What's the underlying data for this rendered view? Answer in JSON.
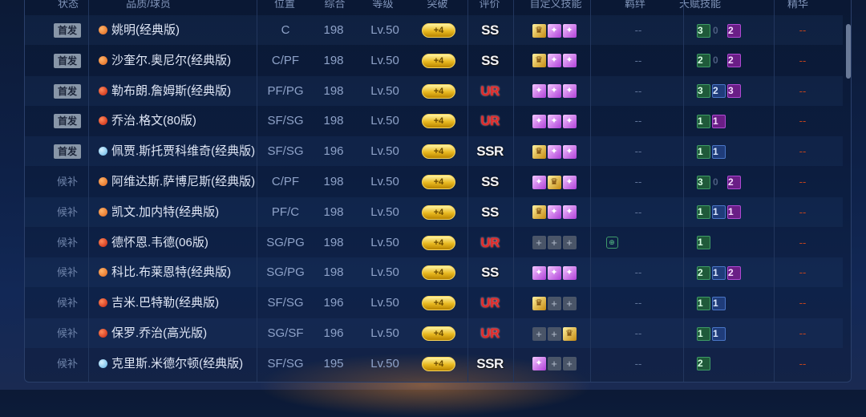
{
  "headers": {
    "status": "状态",
    "player": "品质/球员",
    "position": "位置",
    "overall": "综合",
    "level": "等级",
    "breakthrough": "突破",
    "rating": "评价",
    "custom_skills": "自定义技能",
    "bond": "羁绊",
    "talent_skills": "天赋技能",
    "elite": "精华"
  },
  "players": [
    {
      "status": "首发",
      "name": "姚明(经典版)",
      "dot": "orange",
      "position": "C",
      "overall": "198",
      "level": "Lv.50",
      "break": "+4",
      "grade": "SS",
      "skills": [
        "gold",
        "purple",
        "purple"
      ],
      "bond": "--",
      "talents": [
        [
          "green",
          "3"
        ],
        [
          "zero",
          "0"
        ],
        [
          "purple",
          "2"
        ]
      ],
      "elite": "--"
    },
    {
      "status": "首发",
      "name": "沙奎尔.奥尼尔(经典版)",
      "dot": "orange",
      "position": "C/PF",
      "overall": "198",
      "level": "Lv.50",
      "break": "+4",
      "grade": "SS",
      "skills": [
        "gold",
        "purple",
        "purple"
      ],
      "bond": "--",
      "talents": [
        [
          "green",
          "2"
        ],
        [
          "zero",
          "0"
        ],
        [
          "purple",
          "2"
        ]
      ],
      "elite": "--"
    },
    {
      "status": "首发",
      "name": "勒布朗.詹姆斯(经典版)",
      "dot": "red",
      "position": "PF/PG",
      "overall": "198",
      "level": "Lv.50",
      "break": "+4",
      "grade": "UR",
      "skills": [
        "purple",
        "purple",
        "purple"
      ],
      "bond": "--",
      "talents": [
        [
          "green",
          "3"
        ],
        [
          "blue",
          "2"
        ],
        [
          "purple",
          "3"
        ]
      ],
      "elite": "--"
    },
    {
      "status": "首发",
      "name": "乔治.格文(80版)",
      "dot": "red",
      "position": "SF/SG",
      "overall": "198",
      "level": "Lv.50",
      "break": "+4",
      "grade": "UR",
      "skills": [
        "purple",
        "purple",
        "purple"
      ],
      "bond": "--",
      "talents": [
        [
          "green",
          "1"
        ],
        [
          "purple",
          "1"
        ]
      ],
      "elite": "--"
    },
    {
      "status": "首发",
      "name": "佩贾.斯托贾科维奇(经典版)",
      "dot": "blue",
      "position": "SF/SG",
      "overall": "196",
      "level": "Lv.50",
      "break": "+4",
      "grade": "SSR",
      "skills": [
        "gold",
        "purple",
        "purple"
      ],
      "bond": "--",
      "talents": [
        [
          "green",
          "1"
        ],
        [
          "blue",
          "1"
        ]
      ],
      "elite": "--"
    },
    {
      "status": "候补",
      "name": "阿维达斯.萨博尼斯(经典版)",
      "dot": "orange",
      "position": "C/PF",
      "overall": "198",
      "level": "Lv.50",
      "break": "+4",
      "grade": "SS",
      "skills": [
        "purple",
        "gold",
        "purple"
      ],
      "bond": "--",
      "talents": [
        [
          "green",
          "3"
        ],
        [
          "zero",
          "0"
        ],
        [
          "purple",
          "2"
        ]
      ],
      "elite": "--"
    },
    {
      "status": "候补",
      "name": "凯文.加内特(经典版)",
      "dot": "orange",
      "position": "PF/C",
      "overall": "198",
      "level": "Lv.50",
      "break": "+4",
      "grade": "SS",
      "skills": [
        "gold",
        "purple",
        "purple"
      ],
      "bond": "--",
      "talents": [
        [
          "green",
          "1"
        ],
        [
          "blue",
          "1"
        ],
        [
          "purple",
          "1"
        ]
      ],
      "elite": "--"
    },
    {
      "status": "候补",
      "name": "德怀恩.韦德(06版)",
      "dot": "red",
      "position": "SG/PG",
      "overall": "198",
      "level": "Lv.50",
      "break": "+4",
      "grade": "UR",
      "skills": [
        "empty",
        "empty",
        "empty"
      ],
      "bond": "icon",
      "talents": [
        [
          "green",
          "1"
        ]
      ],
      "elite": "--"
    },
    {
      "status": "候补",
      "name": "科比.布莱恩特(经典版)",
      "dot": "orange",
      "position": "SG/PG",
      "overall": "198",
      "level": "Lv.50",
      "break": "+4",
      "grade": "SS",
      "skills": [
        "purple",
        "purple",
        "purple"
      ],
      "bond": "--",
      "talents": [
        [
          "green",
          "2"
        ],
        [
          "blue",
          "1"
        ],
        [
          "purple",
          "2"
        ]
      ],
      "elite": "--"
    },
    {
      "status": "候补",
      "name": "吉米.巴特勒(经典版)",
      "dot": "red",
      "position": "SF/SG",
      "overall": "196",
      "level": "Lv.50",
      "break": "+4",
      "grade": "UR",
      "skills": [
        "gold",
        "empty",
        "empty"
      ],
      "bond": "--",
      "talents": [
        [
          "green",
          "1"
        ],
        [
          "blue",
          "1"
        ]
      ],
      "elite": "--"
    },
    {
      "status": "候补",
      "name": "保罗.乔治(高光版)",
      "dot": "red",
      "position": "SG/SF",
      "overall": "196",
      "level": "Lv.50",
      "break": "+4",
      "grade": "UR",
      "skills": [
        "empty",
        "empty",
        "gold"
      ],
      "bond": "--",
      "talents": [
        [
          "green",
          "1"
        ],
        [
          "blue",
          "1"
        ]
      ],
      "elite": "--"
    },
    {
      "status": "候补",
      "name": "克里斯.米德尔顿(经典版)",
      "dot": "blue",
      "position": "SF/SG",
      "overall": "195",
      "level": "Lv.50",
      "break": "+4",
      "grade": "SSR",
      "skills": [
        "purple",
        "empty",
        "empty"
      ],
      "bond": "--",
      "talents": [
        [
          "green",
          "2"
        ]
      ],
      "elite": "--"
    }
  ]
}
